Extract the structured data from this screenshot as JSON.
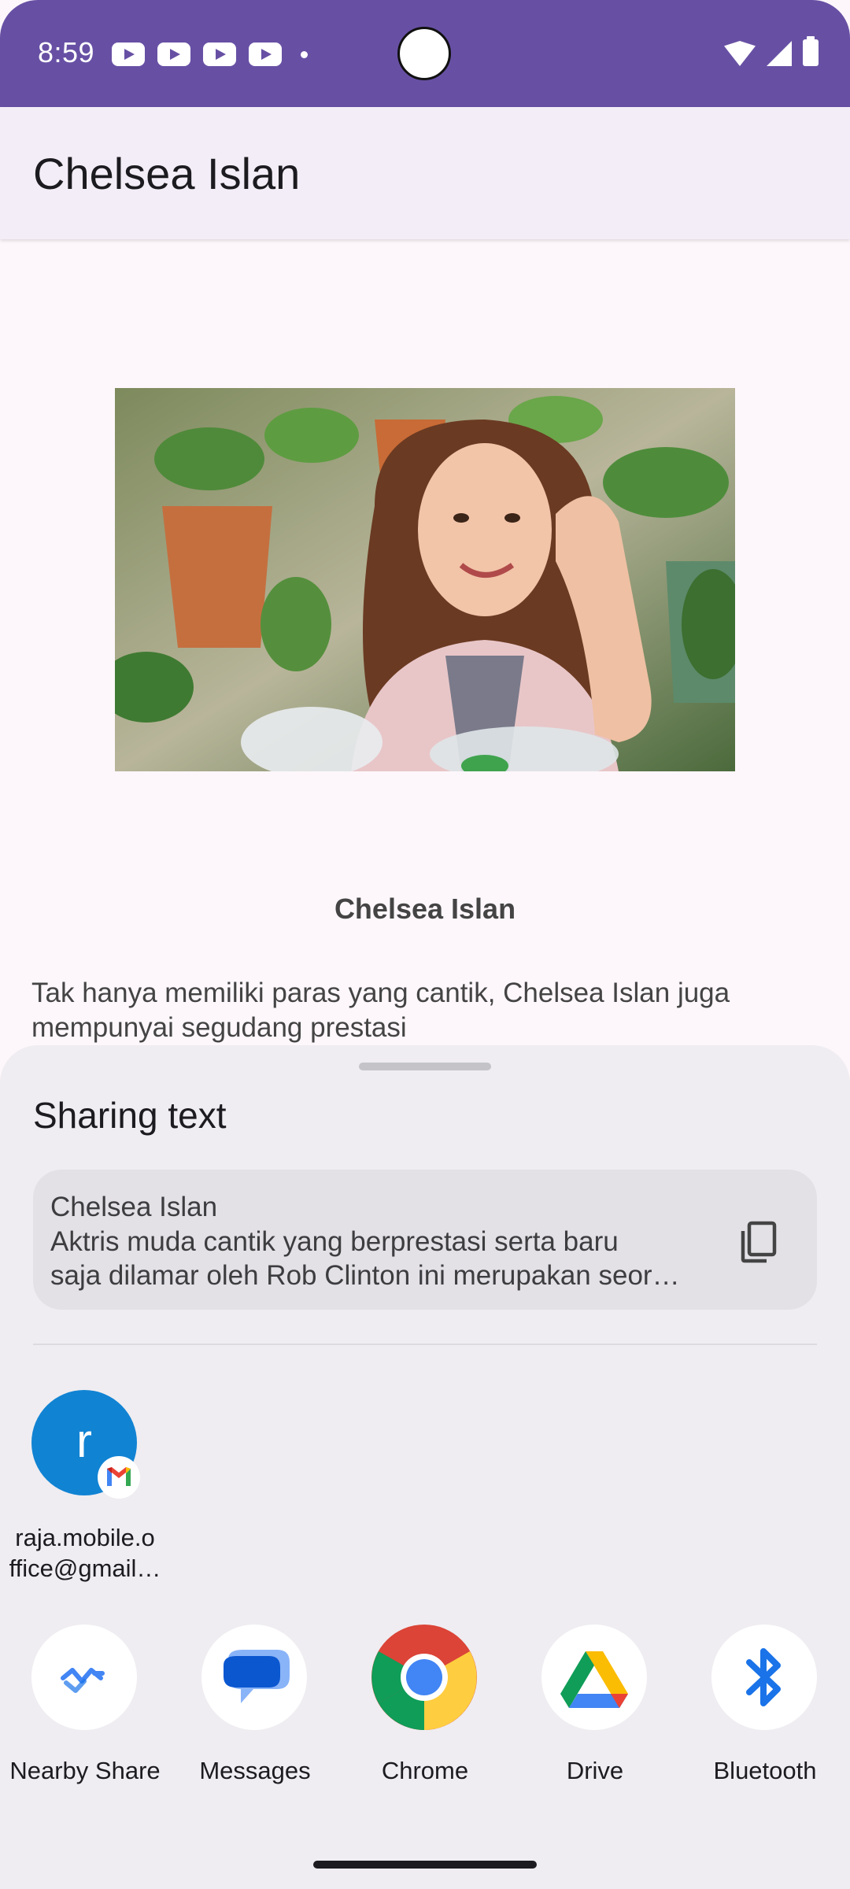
{
  "status_bar": {
    "time": "8:59",
    "notification_icons": [
      "youtube-icon",
      "youtube-icon",
      "youtube-icon",
      "youtube-icon"
    ],
    "background": "#6750a4"
  },
  "app_bar": {
    "title": "Chelsea Islan"
  },
  "detail": {
    "image_alt_icon": "photo-of-person",
    "name": "Chelsea Islan",
    "description": "Tak hanya memiliki paras yang cantik, Chelsea Islan juga mempunyai segudang prestasi"
  },
  "share_sheet": {
    "title": "Sharing text",
    "preview": {
      "title": "Chelsea Islan",
      "line1": "Aktris muda cantik yang berprestasi serta baru",
      "line2": "saja dilamar oleh Rob Clinton ini merupakan seor…"
    },
    "direct_share": {
      "avatar_letter": "r",
      "label": "raja.mobile.office@gmail…",
      "avatar_color": "#1183d3"
    },
    "apps": [
      {
        "label": "Nearby Share",
        "icon": "nearby-share-icon"
      },
      {
        "label": "Messages",
        "icon": "messages-icon"
      },
      {
        "label": "Chrome",
        "icon": "chrome-icon"
      },
      {
        "label": "Drive",
        "icon": "drive-icon"
      },
      {
        "label": "Bluetooth",
        "icon": "bluetooth-icon"
      }
    ]
  }
}
